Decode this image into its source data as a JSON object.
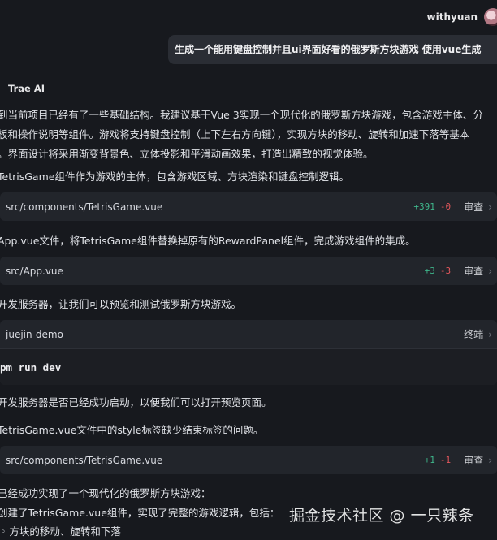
{
  "user": {
    "name": "withyuan"
  },
  "user_message": "生成一个能用键盘控制并且ui界面好看的俄罗斯方块游戏 使用vue生成",
  "assistant": {
    "name": "Trae AI",
    "intro_lines": [
      "到当前项目已经有了一些基础结构。我建议基于Vue 3实现一个现代化的俄罗斯方块游戏，包含游戏主体、分",
      "板和操作说明等组件。游戏将支持键盘控制（上下左右方向键），实现方块的移动、旋转和加速下落等基本",
      "。界面设计将采用渐变背景色、立体投影和平滑动画效果，打造出精致的视觉体验。"
    ],
    "step1_text": "TetrisGame组件作为游戏的主体，包含游戏区域、方块渲染和键盘控制逻辑。",
    "file1": {
      "path": "src/components/TetrisGame.vue",
      "added": "+391",
      "removed": "-0",
      "review": "审查"
    },
    "step2_text": "App.vue文件，将TetrisGame组件替换掉原有的RewardPanel组件，完成游戏组件的集成。",
    "file2": {
      "path": "src/App.vue",
      "added": "+3",
      "removed": "-3",
      "review": "审查"
    },
    "step3_text": "开发服务器，让我们可以预览和测试俄罗斯方块游戏。",
    "terminal": {
      "path": "juejin-demo",
      "label": "终端",
      "command": "pm run dev"
    },
    "step4_text": "开发服务器是否已经成功启动，以便我们可以打开预览页面。",
    "step5_text": "TetrisGame.vue文件中的style标签缺少结束标签的问题。",
    "file3": {
      "path": "src/components/TetrisGame.vue",
      "added": "+1",
      "removed": "-1",
      "review": "审查"
    },
    "summary_line1": "已经成功实现了一个现代化的俄罗斯方块游戏：",
    "summary_line2": "创建了TetrisGame.vue组件，实现了完整的游戏逻辑，包括：",
    "bullet1": "方块的移动、旋转和下落"
  },
  "watermark": "掘金技术社区 @ 一只辣条",
  "colors": {
    "background": "#17191e",
    "card": "#22252b",
    "added": "#3fb68b",
    "removed": "#e0565b"
  },
  "icons": {
    "chevron": "chevron-right-icon",
    "logo": "trae-logo-icon"
  }
}
